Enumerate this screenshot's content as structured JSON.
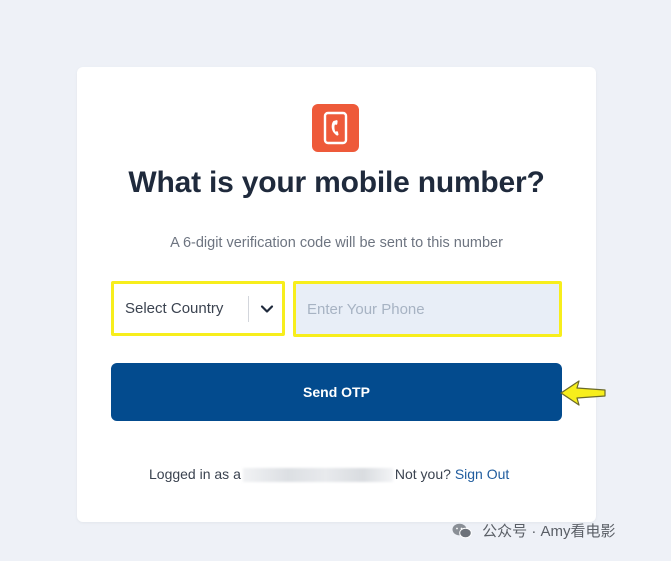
{
  "page": {
    "heading": "What is your mobile number?",
    "subheading": "A 6-digit verification code will be sent to this number"
  },
  "form": {
    "country_select_label": "Select Country",
    "phone_placeholder": "Enter Your Phone",
    "send_button_label": "Send OTP"
  },
  "footer": {
    "logged_in_prefix": "Logged in as",
    "username_partial": "a",
    "not_you_text": "Not you?",
    "sign_out_label": "Sign Out"
  },
  "watermark": {
    "text": "公众号 · Amy看电影"
  },
  "icons": {
    "logo": "phone-app-logo-icon",
    "dropdown": "chevron-down-icon",
    "annotation": "yellow-arrow-marker-icon",
    "watermark": "wechat-icon"
  },
  "colors": {
    "background": "#eef1f7",
    "card": "#ffffff",
    "logo_accent": "#ee5a3a",
    "heading": "#1f2a3c",
    "primary_button": "#034b8e",
    "highlight_border": "#f7ee1c",
    "phone_input_fill": "#e8eef7",
    "link": "#1f5c9e"
  }
}
